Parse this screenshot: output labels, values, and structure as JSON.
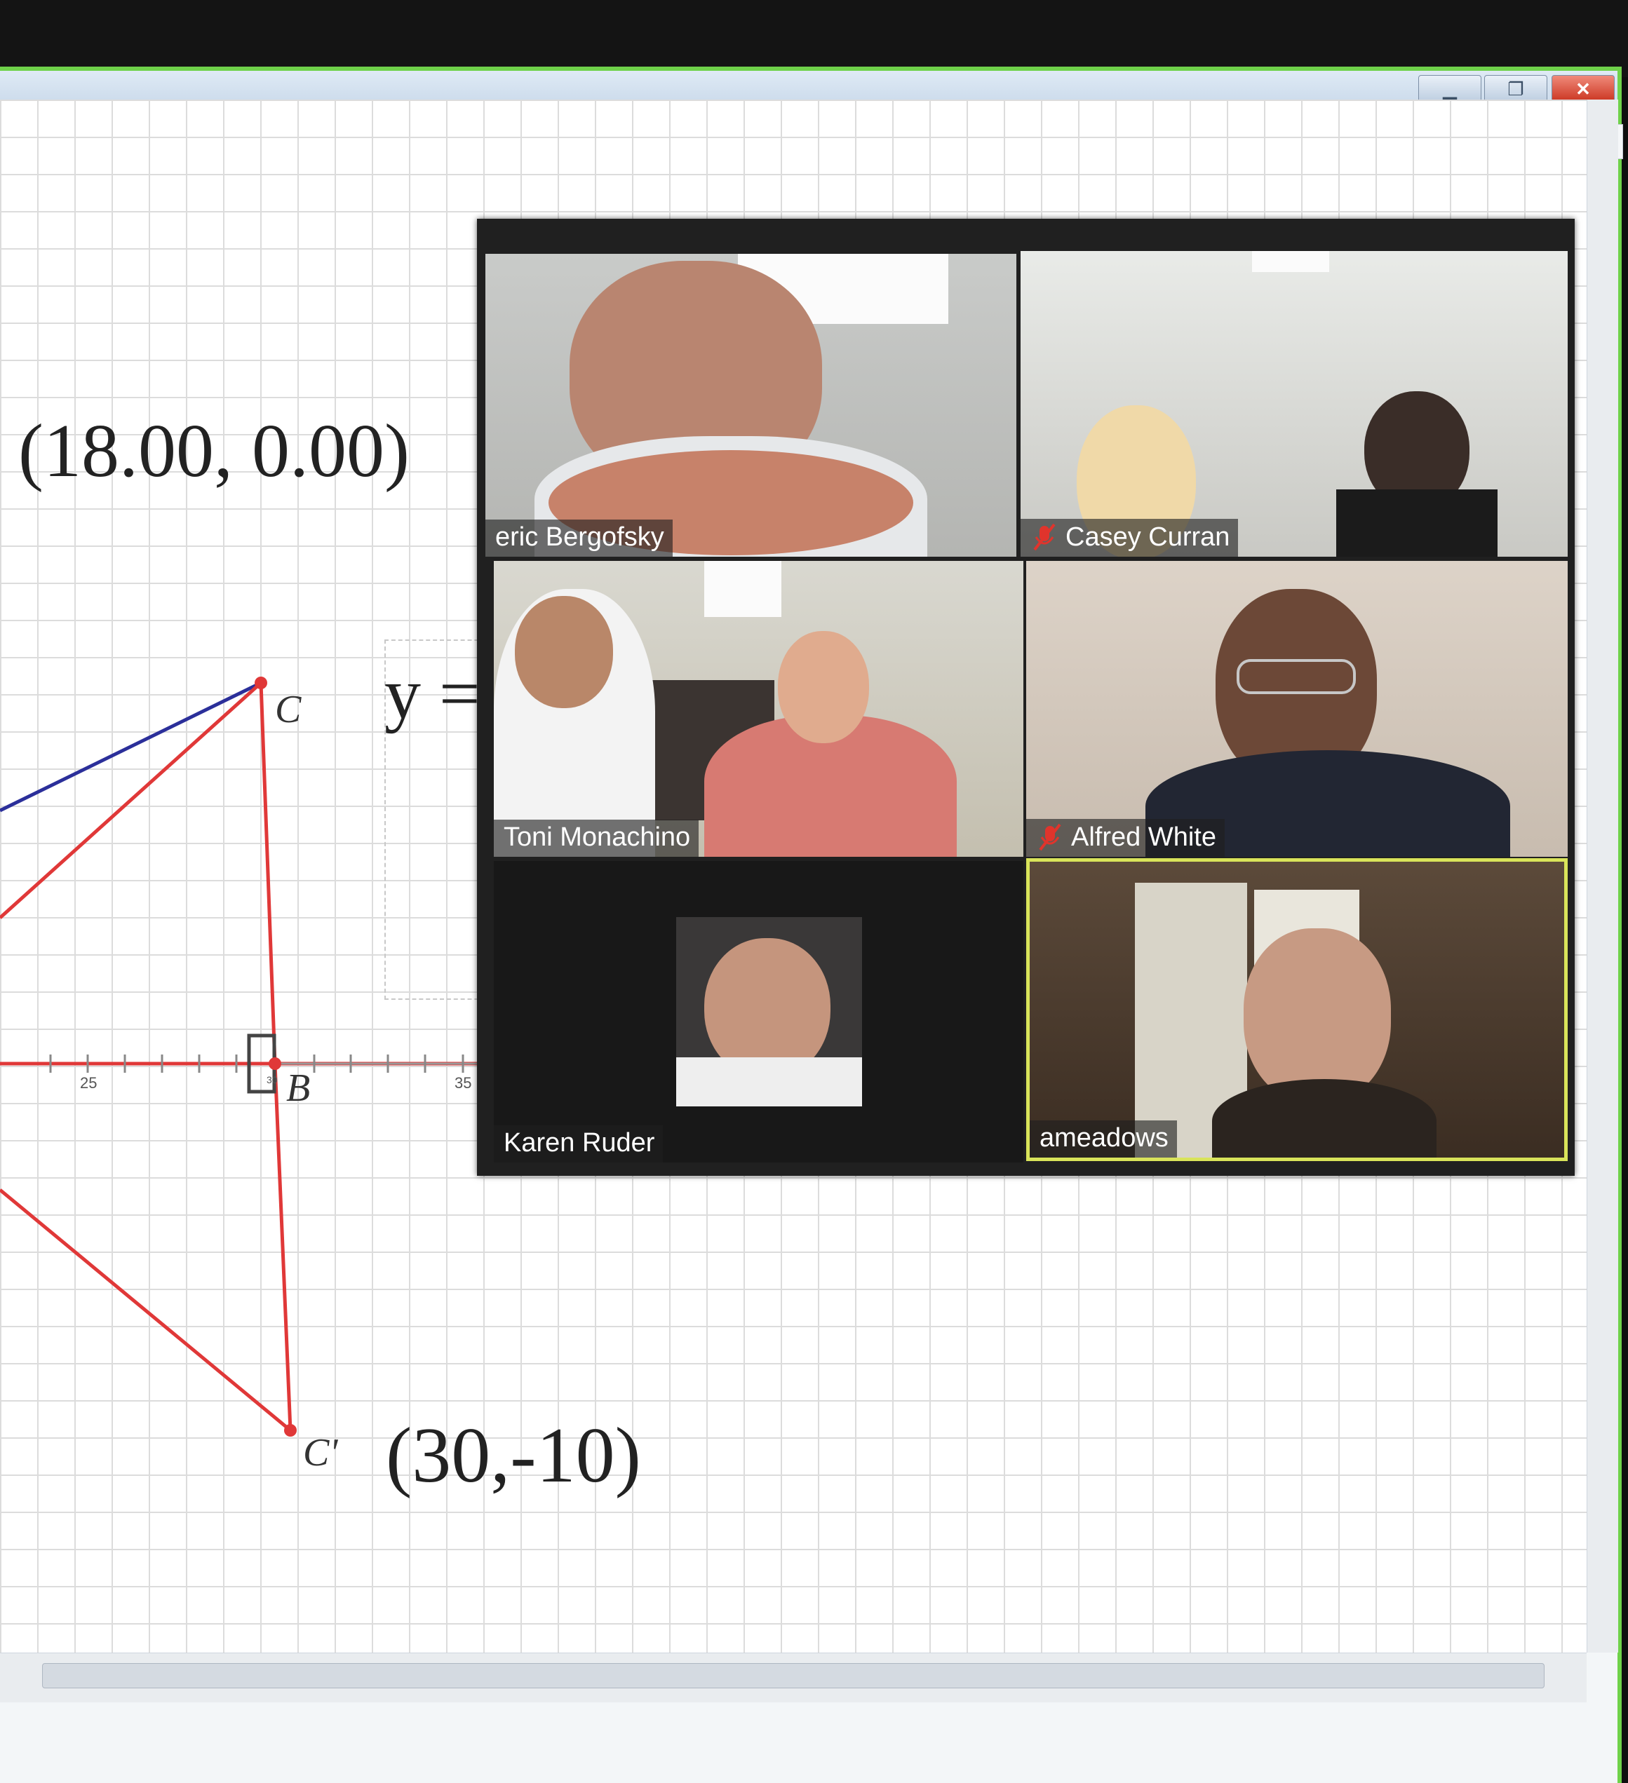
{
  "window": {
    "minimize_icon": "minimize-icon",
    "restore_icon": "restore-icon",
    "close_icon": "close-icon",
    "mdi_minimize": "_",
    "mdi_restore": "▭",
    "mdi_close": "×"
  },
  "geometry": {
    "point_c_coord": "(18.00, 0.00)",
    "point_c_prime_coord": "(30,-10)",
    "equation_prefix": "y =",
    "labels": {
      "c": "C",
      "b": "B",
      "c_prime": "C'"
    },
    "axis_ticks": [
      "25",
      "30",
      "35"
    ],
    "colors": {
      "red": "#e03838",
      "blue": "#2b2f9a",
      "grid": "#dcdcdc"
    }
  },
  "zoom": {
    "participants": [
      {
        "name": "eric Bergofsky",
        "muted": false,
        "active": false
      },
      {
        "name": "Casey Curran",
        "muted": true,
        "active": false
      },
      {
        "name": "Toni Monachino",
        "muted": false,
        "active": false
      },
      {
        "name": "Alfred White",
        "muted": true,
        "active": false
      },
      {
        "name": "Karen Ruder",
        "muted": false,
        "active": false
      },
      {
        "name": "ameadows",
        "muted": false,
        "active": true
      }
    ],
    "muted_icon": "microphone-muted-icon",
    "active_speaker_color": "#d9e45a"
  }
}
